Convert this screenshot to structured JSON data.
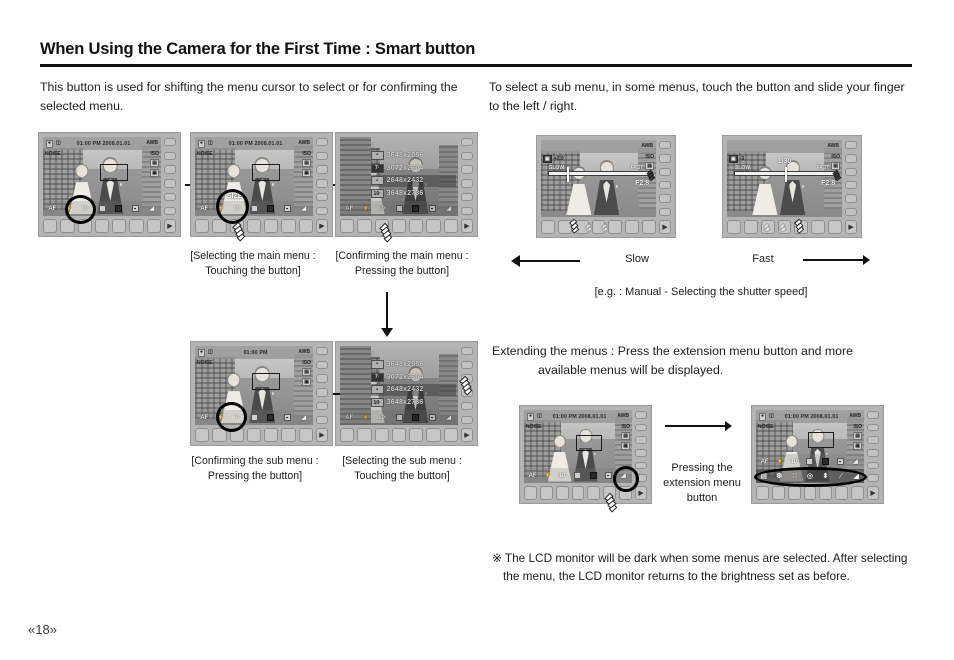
{
  "header": {
    "title": "When Using the Camera for the First Time : Smart button"
  },
  "intro": {
    "left": "This button is used for shifting the menu cursor to select or for confirming the selected menu.",
    "right": "To select a sub menu, in some menus, touch the button and slide your finger to the left / right."
  },
  "captions": {
    "selecting_main": "[Selecting the main menu :\nTouching the button]",
    "selecting_main_l1": "[Selecting the main menu :",
    "selecting_main_l2": "Touching the button]",
    "confirming_main_l1": "[Confirming the main menu :",
    "confirming_main_l2": "Pressing the button]",
    "confirming_sub_l1": "[Confirming the sub menu :",
    "confirming_sub_l2": "Pressing the button]",
    "selecting_sub_l1": "[Selecting the sub menu :",
    "selecting_sub_l2": "Touching the button]"
  },
  "slider_section": {
    "slow_label": "Slow",
    "fast_label": "Fast",
    "example_note": "[e.g. : Manual - Selecting the shutter speed]"
  },
  "extend": {
    "line1": "Extending the menus : Press the extension menu button and more",
    "line2": "available menus will be displayed.",
    "press_label_l1": "Pressing the",
    "press_label_l2": "extension menu",
    "press_label_l3": "button"
  },
  "footnote": {
    "mark": "※",
    "line1": "The LCD monitor will be dark when some menus are selected. After  selecting",
    "line2": "the menu, the LCD monitor returns to the brightness set as before."
  },
  "page_number": "«18»",
  "lcd": {
    "datetime": "01:00 PM 2008.01.01",
    "datetime_short": "01:00 PM",
    "awb": "AWB",
    "iso": "ISO",
    "noise": "NOISE",
    "af": "AF",
    "flash": "⚡",
    "size_label": "SIZE",
    "size_10": "10·",
    "size_7": "7·",
    "shutter_speed": "1/30",
    "aperture": "F2.8",
    "ev_plus": "+2.0",
    "ev_minus": "-3",
    "slow": "SLOW",
    "fast": "FAST"
  },
  "resolutions": [
    {
      "chip": "•",
      "value": "3648x2056",
      "selected": false
    },
    {
      "chip": "7·",
      "value": "3072x2304",
      "selected": true
    },
    {
      "chip": "•",
      "value": "2648x2432",
      "selected": false
    },
    {
      "chip": "10·",
      "value": "3648x2736",
      "selected": false
    }
  ],
  "ext_menu_icons": [
    "▤",
    "❆",
    "∷",
    "◎",
    "⬍",
    "∕",
    "◢"
  ],
  "colors": {
    "ink": "#111111",
    "body_text": "#1c1c1c",
    "camera_body": "#b4b4b4",
    "lcd_base": "#9a9a9a",
    "ring": "#000000"
  }
}
